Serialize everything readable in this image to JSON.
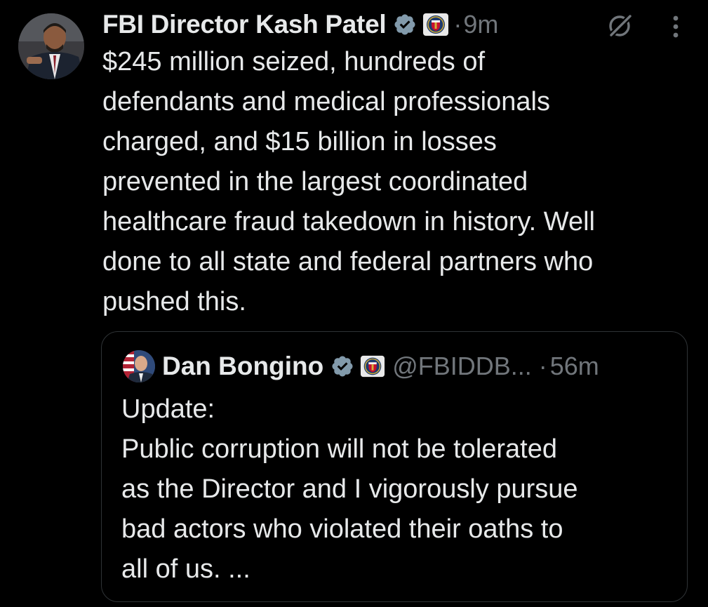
{
  "tweet": {
    "author_name": "FBI Director Kash Patel",
    "dot": "·",
    "timestamp": "9m",
    "text": "$245 million seized, hundreds of\ndefendants and medical professionals\ncharged, and $15 billion in losses\nprevented in the largest coordinated\nhealthcare fraud takedown in history. Well\ndone to all state and federal partners who\npushed this."
  },
  "quote": {
    "author_name": "Dan Bongino",
    "handle": "@FBIDDB...",
    "dot": "·",
    "timestamp": "56m",
    "text": "Update:\nPublic corruption will not be tolerated\nas the Director and I vigorously pursue\nbad actors who violated their oaths to\nall of us. ..."
  },
  "icons": {
    "verified": "verified-badge-icon",
    "affiliation": "fbi-seal-icon",
    "grok": "grok-icon",
    "more": "more-vertical-icon"
  },
  "colors": {
    "background": "#000000",
    "text": "#e7e9ea",
    "secondary": "#71767b",
    "border": "#2f3336",
    "verified_badge": "#829aab"
  }
}
